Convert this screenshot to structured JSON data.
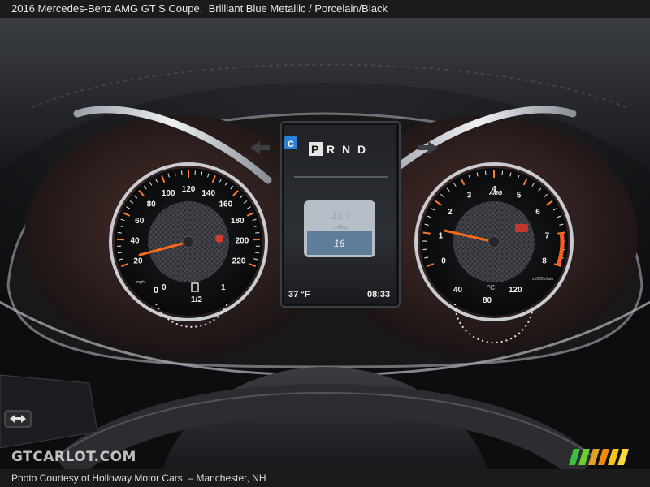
{
  "caption": {
    "title": "2016 Mercedes-Benz AMG GT S Coupe,",
    "color": "Brilliant Blue Metallic",
    "separator": "/",
    "interior": "Porcelain/Black"
  },
  "credit": {
    "text": "Photo Courtesy of Holloway Motor Cars",
    "dash": "–",
    "location": "Manchester, NH"
  },
  "watermark": {
    "text": "GTCARLOT.COM"
  },
  "cluster": {
    "speedometer": {
      "labels": [
        "20",
        "40",
        "60",
        "80",
        "100",
        "120",
        "140",
        "160",
        "180",
        "200",
        "220"
      ],
      "min_label": "0",
      "unit": "mph",
      "needle_value": 5
    },
    "tachometer": {
      "labels": [
        "0",
        "1",
        "2",
        "3",
        "4",
        "5",
        "6",
        "7",
        "8"
      ],
      "unit": "x1000 r/min",
      "redline": 7,
      "needle_value": 1.2
    },
    "fuel_gauge": {
      "labels": [
        "0",
        "1/2",
        "1"
      ],
      "level": 0.5
    },
    "temp_gauge": {
      "labels": [
        "40",
        "80",
        "120"
      ],
      "unit": "°C"
    },
    "gear_indicator": {
      "letters": [
        "P",
        "R",
        "N",
        "D"
      ],
      "selected": "P"
    },
    "display": {
      "trip_value": "13.7",
      "trip_unit": "miles",
      "secondary_value": "16",
      "outside_temp": "37 °F",
      "clock": "08:33"
    }
  },
  "colors": {
    "needle": "#ff6a1a",
    "gauge_ring": "#d9dde3",
    "screen_blue": "#2c7fd6"
  }
}
